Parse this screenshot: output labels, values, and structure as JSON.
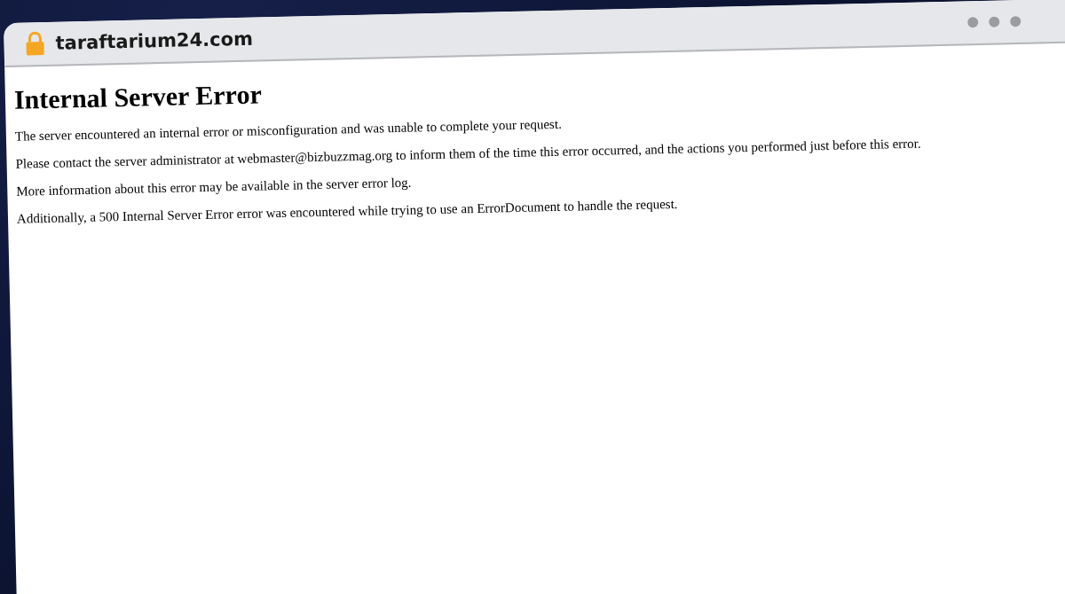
{
  "browser": {
    "url": "taraftarium24.com"
  },
  "page": {
    "heading": "Internal Server Error",
    "paragraphs": [
      "The server encountered an internal error or misconfiguration and was unable to complete your request.",
      "Please contact the server administrator at webmaster@bizbuzzmag.org to inform them of the time this error occurred, and the actions you performed just before this error.",
      "More information about this error may be available in the server error log.",
      "Additionally, a 500 Internal Server Error error was encountered while trying to use an ErrorDocument to handle the request."
    ]
  }
}
